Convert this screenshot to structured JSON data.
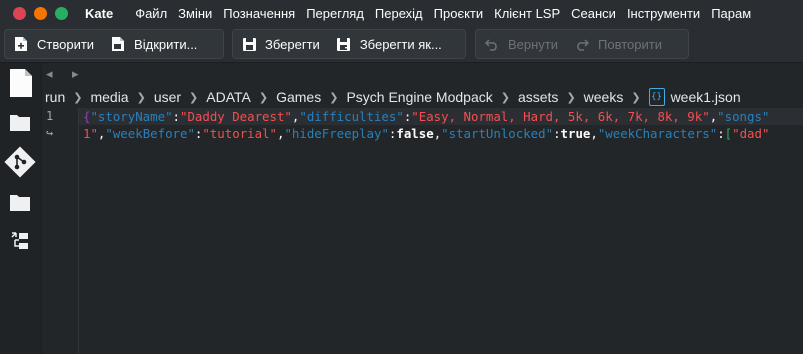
{
  "app": {
    "title": "Kate"
  },
  "window_controls": {
    "close_color": "#da4453",
    "minimize_color": "#f67400",
    "maximize_color": "#27ae60"
  },
  "menu": [
    "Файл",
    "Зміни",
    "Позначення",
    "Перегляд",
    "Перехід",
    "Проєкти",
    "Клієнт LSP",
    "Сеанси",
    "Інструменти",
    "Парам"
  ],
  "toolbar": {
    "new_label": "Створити",
    "open_label": "Відкрити...",
    "save_label": "Зберегти",
    "save_as_label": "Зберегти як...",
    "undo_label": "Вернути",
    "redo_label": "Повторити"
  },
  "sidebar": {
    "icons": [
      "document-icon",
      "folder-icon",
      "git-icon",
      "folder-icon",
      "project-tree-icon"
    ]
  },
  "nav": {
    "back": "◂",
    "forward": "▸"
  },
  "breadcrumb": [
    "run",
    "media",
    "user",
    "ADATA",
    "Games",
    "Psych Engine Modpack",
    "assets",
    "weeks",
    "week1.json"
  ],
  "editor": {
    "line_numbers": [
      "1",
      "↪"
    ],
    "line1": {
      "t1": "{",
      "t2": "\"storyName\"",
      "t3": ":",
      "t4": "\"Daddy Dearest\"",
      "t5": ",",
      "t6": "\"difficulties\"",
      "t7": ":",
      "t8": "\"Easy, Normal, Hard, 5k, 6k, 7k, 8k, 9k\"",
      "t9": ",",
      "t10": "\"songs\""
    },
    "line2": {
      "t1": "1\"",
      "t2": ",",
      "t3": "\"weekBefore\"",
      "t4": ":",
      "t5": "\"tutorial\"",
      "t6": ",",
      "t7": "\"hideFreeplay\"",
      "t8": ":",
      "t9": "false",
      "t10": ",",
      "t11": "\"startUnlocked\"",
      "t12": ":",
      "t13": "true",
      "t14": ",",
      "t15": "\"weekCharacters\"",
      "t16": ":",
      "t17": "[",
      "t18": "\"dad\""
    }
  }
}
